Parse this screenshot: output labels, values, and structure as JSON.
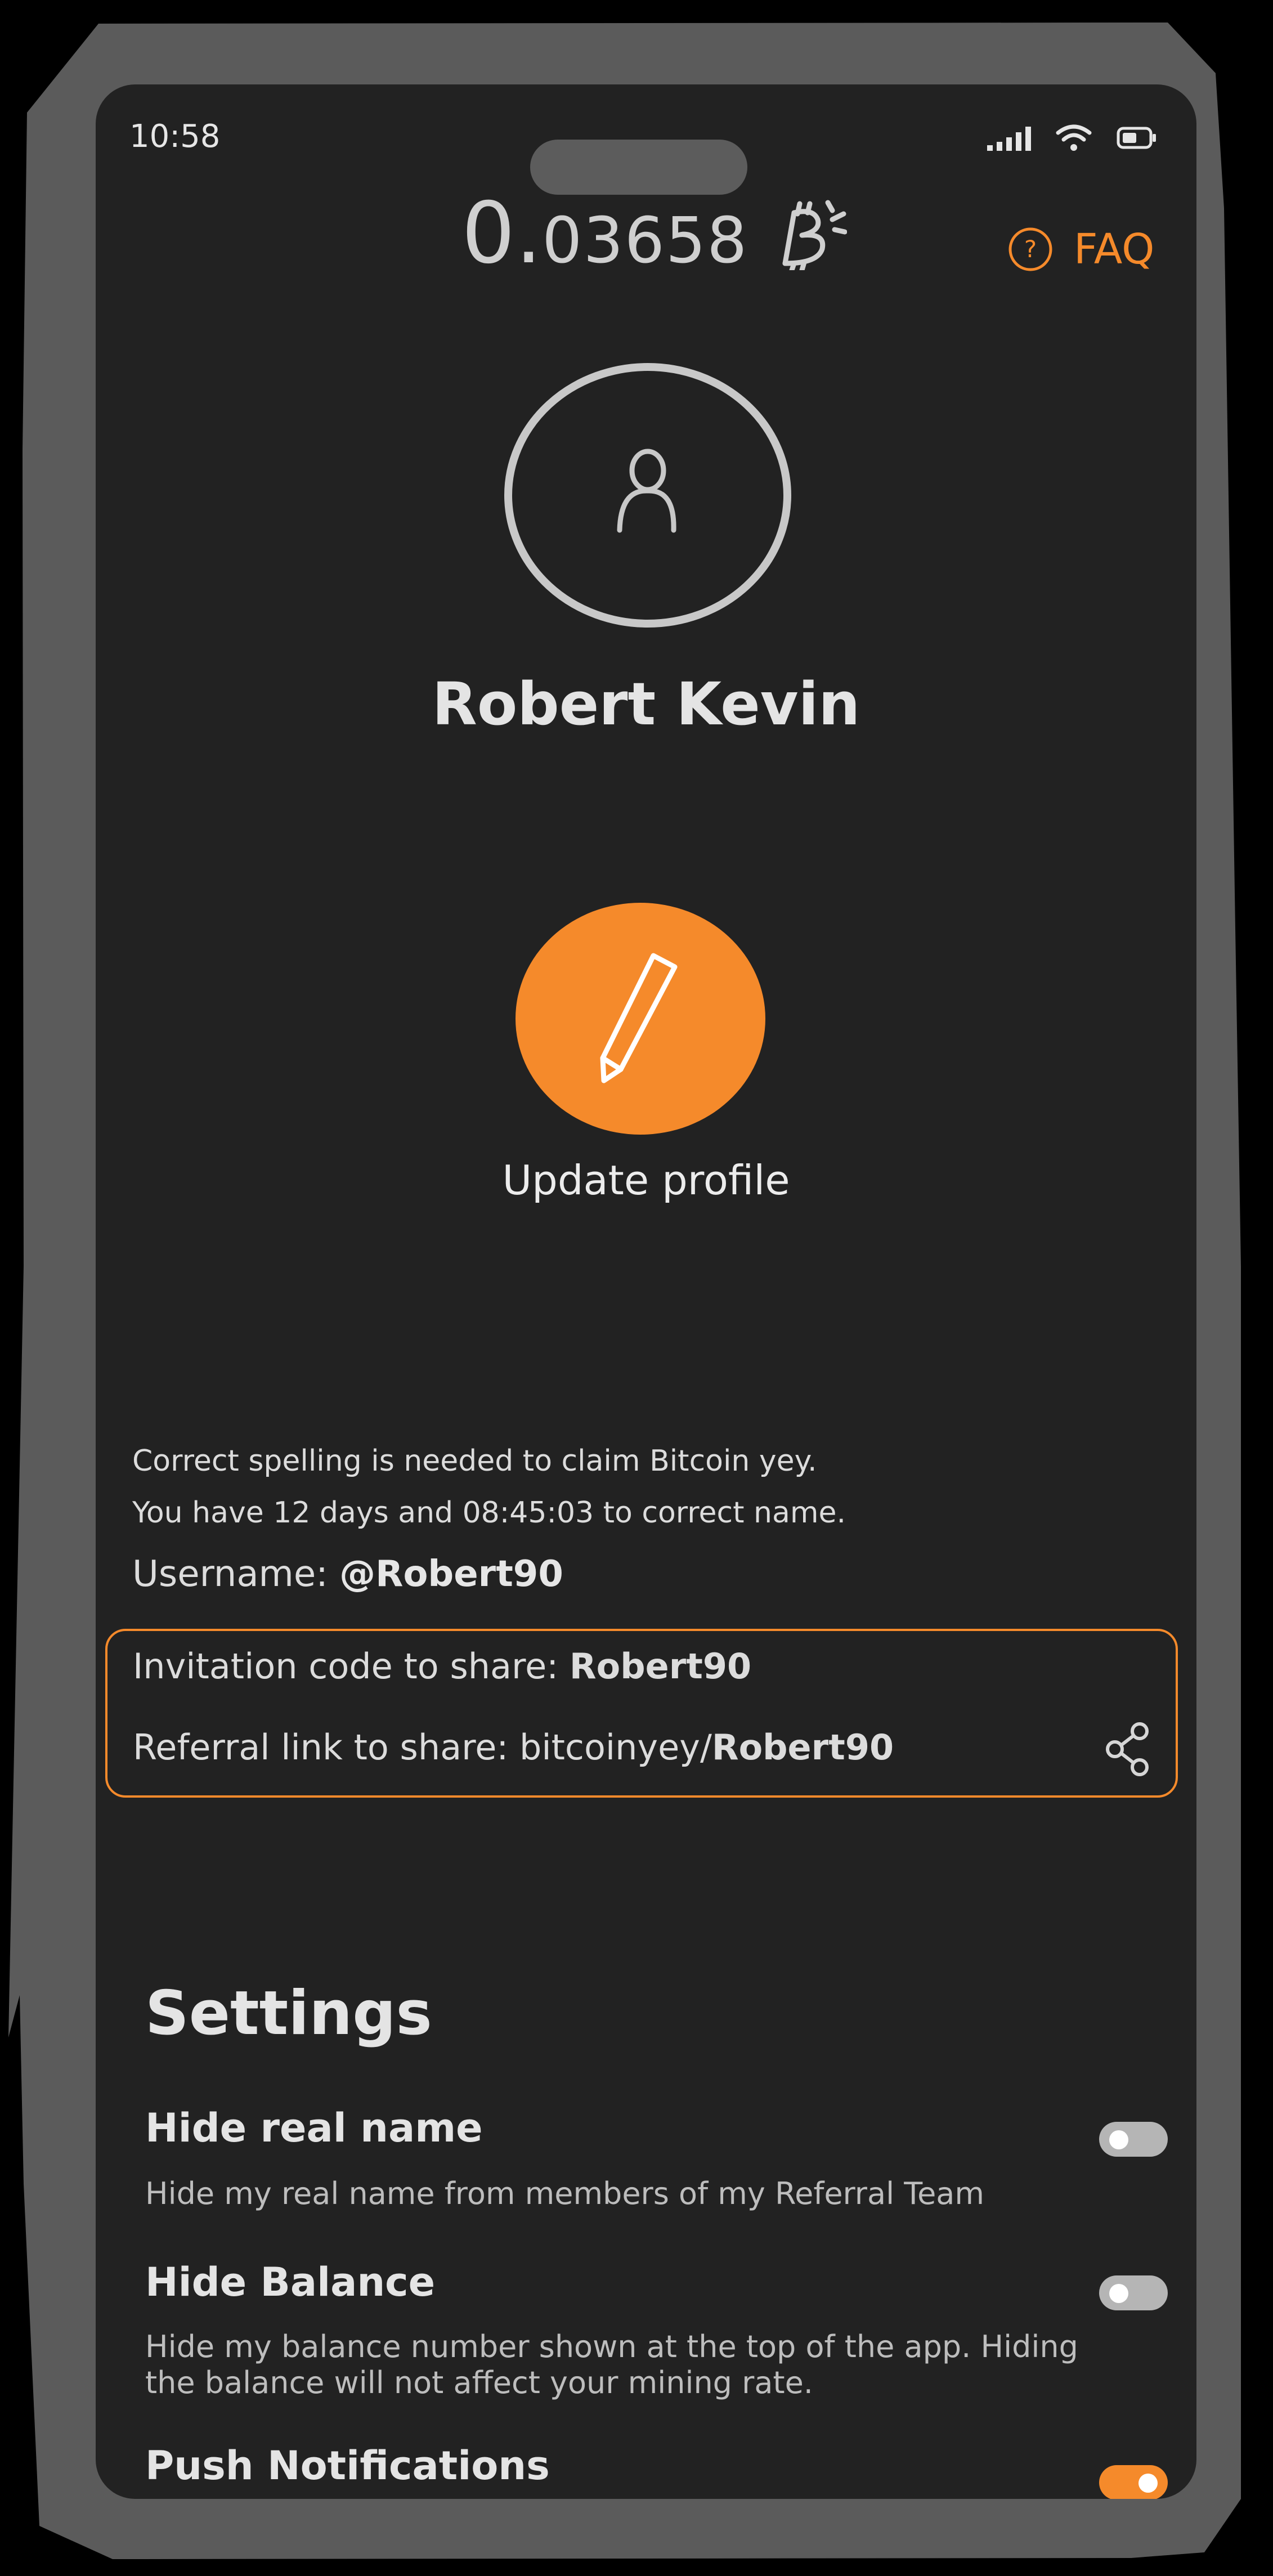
{
  "status_bar": {
    "time": "10:58",
    "icons": [
      "signal-icon",
      "wifi-icon",
      "battery-icon"
    ]
  },
  "header": {
    "balance_integer": "0.",
    "balance_decimal": "03658",
    "currency_icon": "bitcoin-icon",
    "faq_label": "FAQ",
    "faq_icon": "question-circle-icon",
    "accent_color": "#f58a2b"
  },
  "profile": {
    "name": "Robert Kevin",
    "avatar_icon": "user-icon",
    "update_button_icon": "pencil-icon",
    "update_label": "Update profile"
  },
  "notice": {
    "line1": "Correct spelling is needed to claim Bitcoin yey.",
    "line2": "You have 12 days and 08:45:03 to correct name."
  },
  "account": {
    "username_label": "Username: ",
    "username_value": "@Robert90",
    "invitation_label": "Invitation code to share: ",
    "invitation_value": "Robert90",
    "referral_label": "Referral link to share: bitcoinyey/",
    "referral_value": "Robert90",
    "share_icon": "share-icon"
  },
  "settings": {
    "title": "Settings",
    "items": [
      {
        "title": "Hide real name",
        "description": "Hide my real name from members of my Referral Team",
        "enabled": false
      },
      {
        "title": "Hide Balance",
        "description": "Hide my balance number shown at the top of the app. Hiding the balance will not affect your mining rate.",
        "enabled": false
      },
      {
        "title": "Push Notifications",
        "description": "",
        "enabled": true
      }
    ]
  }
}
